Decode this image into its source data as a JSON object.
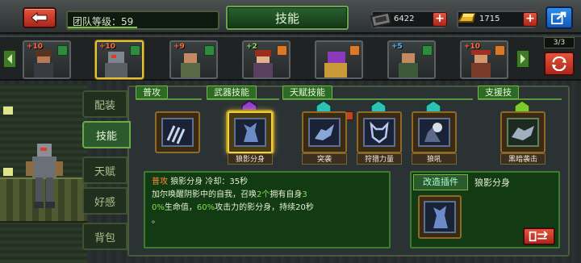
{
  "header": {
    "team_level_label": "团队等级：59",
    "title": "技能",
    "gear_count": "6422",
    "gold_count": "1715",
    "team_level_progress": 0.46
  },
  "roster": {
    "count": "3/3",
    "heroes": [
      {
        "level": "+10",
        "level_color": "orange",
        "selected": false
      },
      {
        "level": "+10",
        "level_color": "orange",
        "selected": true
      },
      {
        "level": "+9",
        "level_color": "orange",
        "selected": false
      },
      {
        "level": "+2",
        "level_color": "green",
        "selected": false
      },
      {
        "level": "",
        "level_color": "orange",
        "selected": false
      },
      {
        "level": "+5",
        "level_color": "blue",
        "selected": false
      },
      {
        "level": "+10",
        "level_color": "orange",
        "selected": false
      }
    ]
  },
  "tabs": [
    "配装",
    "技能",
    "天赋",
    "好感",
    "背包"
  ],
  "active_tab": "技能",
  "sections": {
    "normal": "普攻",
    "weapon": "武器技能",
    "talent": "天赋技能",
    "support": "支援技"
  },
  "skills": [
    {
      "name": "",
      "selected": false
    },
    {
      "name": "狼影分身",
      "selected": true
    },
    {
      "name": "突袭",
      "selected": false
    },
    {
      "name": "狩猎力量",
      "selected": false
    },
    {
      "name": "狼吼",
      "selected": false
    },
    {
      "name": "黑暗袭击",
      "selected": false
    }
  ],
  "description": {
    "tag": "普攻",
    "skill_name": "狼影分身",
    "cooldown": "冷却：35秒",
    "line1a": "加尔唤醒阴影中的自我，召唤",
    "line1b": "2个",
    "line1c": "拥有自身",
    "line1d": "3",
    "line2a": "0%",
    "line2b": "生命值，",
    "line2c": "60%",
    "line2d": "攻击力的影分身，持续20秒",
    "line3": "。"
  },
  "plugin": {
    "tab_label": "改造插件",
    "name": "狼影分身"
  },
  "colors": {
    "accent_green": "#2b5a2c",
    "highlight_orange": "#ff8a3a",
    "highlight_green": "#7fe050",
    "highlight_blue": "#62b8ff",
    "red_button": "#c7341f"
  }
}
